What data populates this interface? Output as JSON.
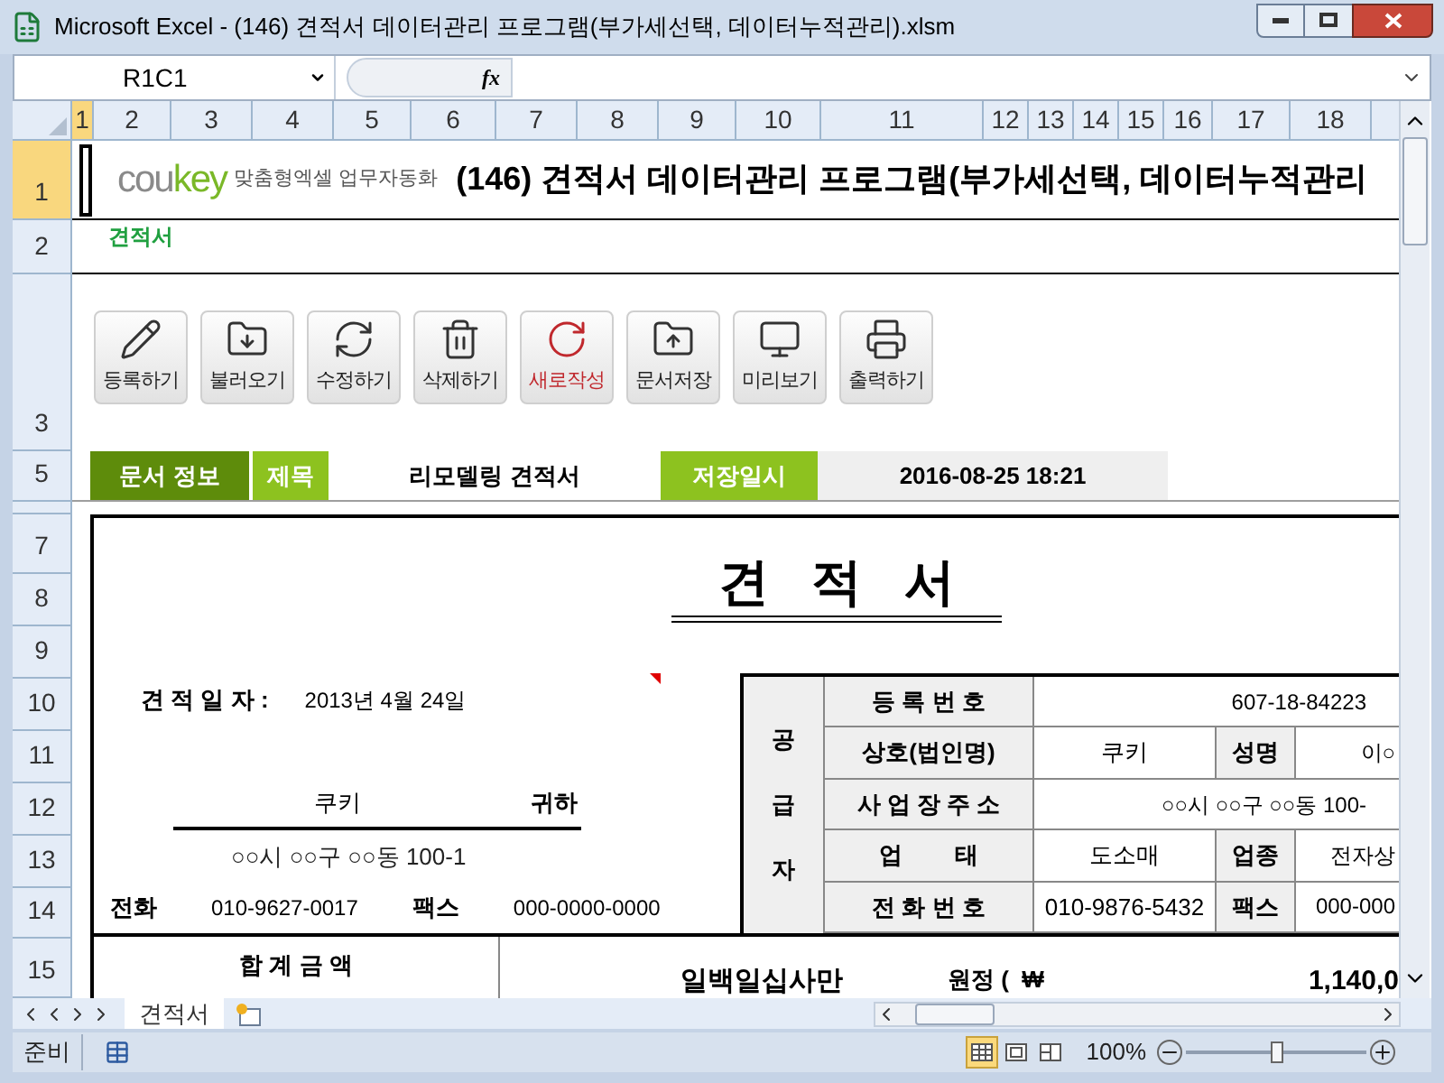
{
  "window": {
    "title": "Microsoft Excel - (146) 견적서 데이터관리 프로그램(부가세선택, 데이터누적관리).xlsm"
  },
  "formula_bar": {
    "name_box": "R1C1",
    "fx": "fx"
  },
  "columns": [
    {
      "label": "1",
      "selected": true
    },
    {
      "label": "2",
      "selected": false
    },
    {
      "label": "3",
      "selected": false
    },
    {
      "label": "4",
      "selected": false
    },
    {
      "label": "5",
      "selected": false
    },
    {
      "label": "6",
      "selected": false
    },
    {
      "label": "7",
      "selected": false
    },
    {
      "label": "8",
      "selected": false
    },
    {
      "label": "9",
      "selected": false
    },
    {
      "label": "10",
      "selected": false
    },
    {
      "label": "11",
      "selected": false
    },
    {
      "label": "12",
      "selected": false
    },
    {
      "label": "13",
      "selected": false
    },
    {
      "label": "14",
      "selected": false
    },
    {
      "label": "15",
      "selected": false
    },
    {
      "label": "16",
      "selected": false
    },
    {
      "label": "17",
      "selected": false
    },
    {
      "label": "18",
      "selected": false
    }
  ],
  "rows": [
    {
      "label": "1",
      "selected": true
    },
    {
      "label": "2",
      "selected": false
    },
    {
      "label": "3",
      "selected": false
    },
    {
      "label": "5",
      "selected": false
    },
    {
      "label": "7",
      "selected": false
    },
    {
      "label": "8",
      "selected": false
    },
    {
      "label": "9",
      "selected": false
    },
    {
      "label": "10",
      "selected": false
    },
    {
      "label": "11",
      "selected": false
    },
    {
      "label": "12",
      "selected": false
    },
    {
      "label": "13",
      "selected": false
    },
    {
      "label": "14",
      "selected": false
    },
    {
      "label": "15",
      "selected": false
    }
  ],
  "banner": {
    "logo_gray": "cou",
    "logo_green": "key",
    "tagline": "맞춤형엑셀 업무자동화",
    "title": "(146) 견적서 데이터관리 프로그램(부가세선택, 데이터누적관리"
  },
  "sheet_subtitle": "견적서",
  "toolbar": [
    {
      "kind": "pencil",
      "label": "등록하기",
      "highlighted": false
    },
    {
      "kind": "folder-down",
      "label": "불러오기",
      "highlighted": false
    },
    {
      "kind": "refresh",
      "label": "수정하기",
      "highlighted": false
    },
    {
      "kind": "trash",
      "label": "삭제하기",
      "highlighted": false
    },
    {
      "kind": "rotate",
      "label": "새로작성",
      "highlighted": true
    },
    {
      "kind": "folder-up",
      "label": "문서저장",
      "highlighted": false
    },
    {
      "kind": "monitor",
      "label": "미리보기",
      "highlighted": false
    },
    {
      "kind": "printer",
      "label": "출력하기",
      "highlighted": false
    }
  ],
  "doc_info": {
    "section": "문서 정보",
    "title_label": "제목",
    "title_value": "리모델링 견적서",
    "saved_label": "저장일시",
    "saved_value": "2016-08-25 18:21"
  },
  "quote": {
    "heading": "견   적   서",
    "date_label": "견 적 일 자 :",
    "date_value": "2013년 4월 24일",
    "recipient": "쿠키",
    "honorific": "귀하",
    "recipient_address": "○○시 ○○구 ○○동 100-1",
    "phone_label": "전화",
    "phone": "010-9627-0017",
    "fax_label": "팩스",
    "fax": "000-0000-0000",
    "supplier": {
      "side_label": "공급자",
      "rows": [
        {
          "label": "등 록 번 호",
          "value": "607-18-84223"
        },
        {
          "label": "상호(법인명)",
          "value": "쿠키",
          "label2": "성명",
          "value2": "이○"
        },
        {
          "label": "사 업 장 주 소",
          "value": "○○시 ○○구 ○○동 100-"
        },
        {
          "label": "업        태",
          "value": "도소매",
          "label2": "업종",
          "value2": "전자상"
        },
        {
          "label": "전 화 번 호",
          "value": "010-9876-5432",
          "label2": "팩스",
          "value2": "000-000"
        }
      ]
    },
    "total_label": "합 계 금 액",
    "total_words": "일백일십사만",
    "won_label": "원정 (  ₩",
    "total_amount": "1,140,0"
  },
  "sheet_tabs": [
    {
      "label": "견적서",
      "selected": true
    }
  ],
  "status_bar": {
    "status": "준비",
    "zoom": "100%",
    "zoom_slider": {
      "level": 0.5
    },
    "views": [
      {
        "kind": "normal",
        "selected": true
      },
      {
        "kind": "layout",
        "selected": false
      },
      {
        "kind": "pagebreak",
        "selected": false
      }
    ]
  }
}
